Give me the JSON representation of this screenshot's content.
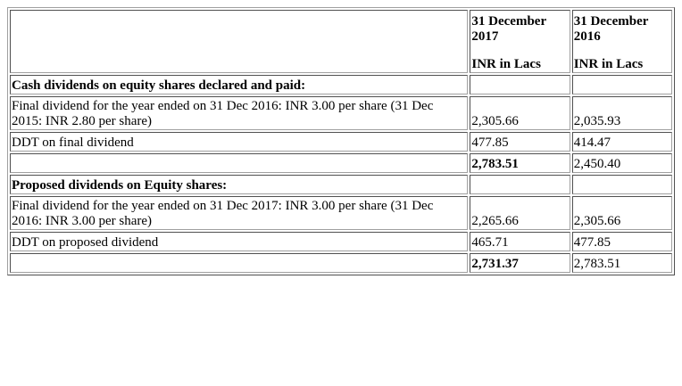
{
  "table": {
    "header": {
      "col1_line1": "31 December",
      "col1_line2": "2017",
      "col1_unit": "INR in Lacs",
      "col2_line1": "31 December",
      "col2_line2": "2016",
      "col2_unit": "INR in Lacs"
    },
    "rows": [
      {
        "desc": "Cash dividends on equity shares declared and paid:",
        "v2017": "",
        "v2016": ""
      },
      {
        "desc": "Final dividend for the year ended on 31 Dec 2016: INR 3.00 per share (31 Dec 2015: INR 2.80 per share)",
        "v2017": "2,305.66",
        "v2016": "2,035.93"
      },
      {
        "desc": "DDT on final dividend",
        "v2017": "477.85",
        "v2016": "414.47"
      },
      {
        "desc": "",
        "v2017": "2,783.51",
        "v2016": "2,450.40"
      },
      {
        "desc": "Proposed dividends on Equity shares:",
        "v2017": "",
        "v2016": ""
      },
      {
        "desc": "Final dividend for the year ended on 31 Dec 2017: INR 3.00 per share (31 Dec 2016: INR 3.00 per share)",
        "v2017": "2,265.66",
        "v2016": "2,305.66"
      },
      {
        "desc": "DDT on proposed dividend",
        "v2017": "465.71",
        "v2016": "477.85"
      },
      {
        "desc": "",
        "v2017": "2,731.37",
        "v2016": "2,783.51"
      }
    ]
  }
}
